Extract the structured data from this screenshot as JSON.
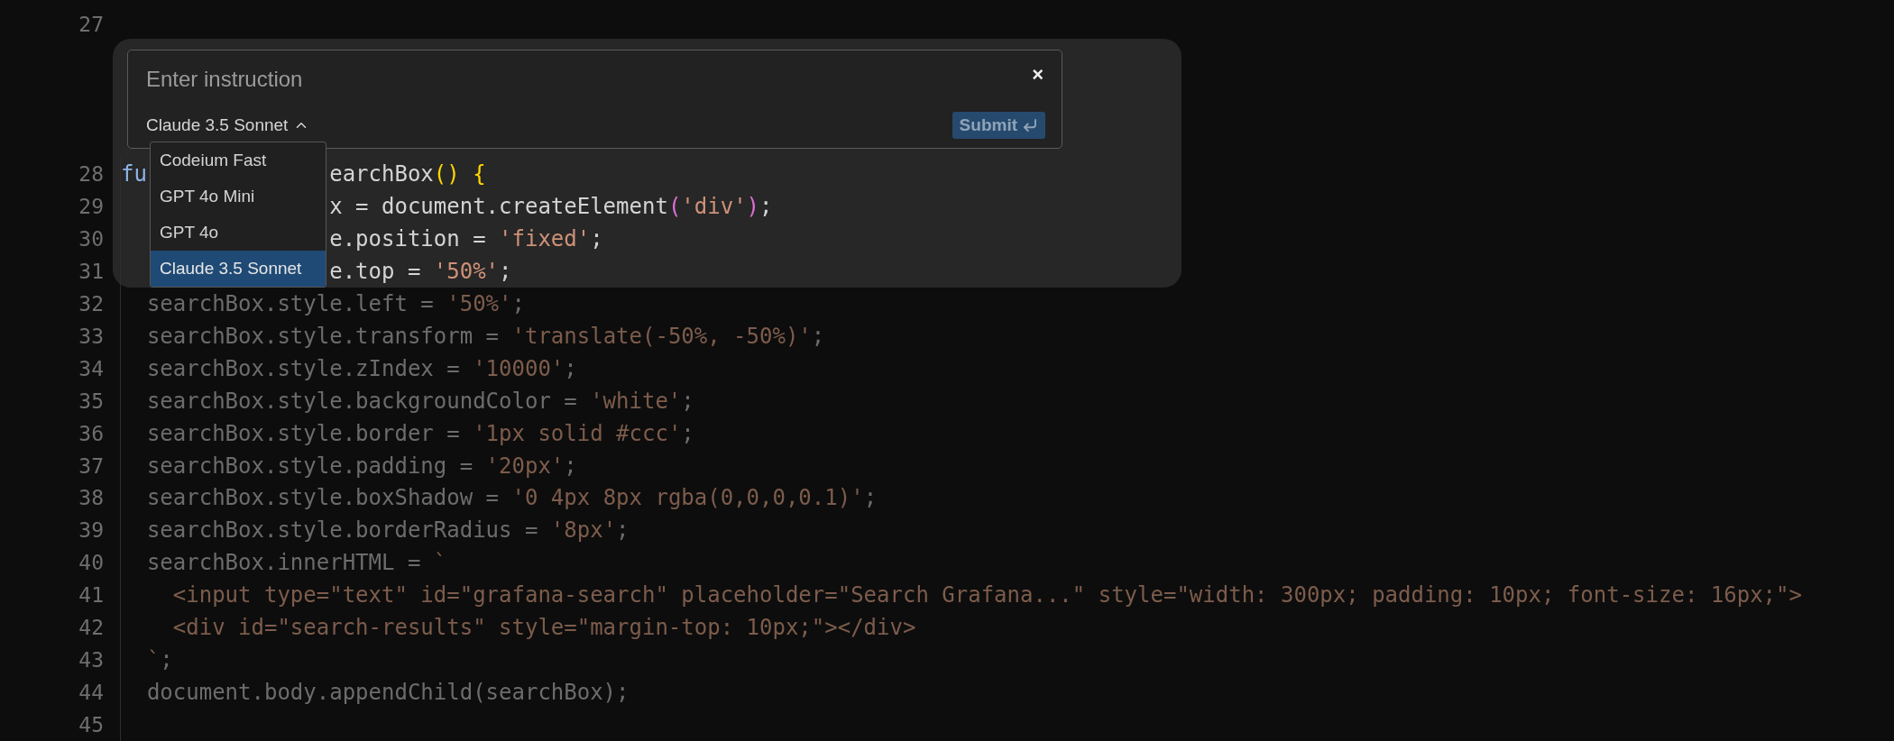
{
  "editor": {
    "lines": [
      {
        "number": "27"
      },
      {
        "number": "28",
        "dimmed": false,
        "covered": true,
        "lead": [
          {
            "kind": "keyword",
            "text": "fu"
          }
        ],
        "tokens": [
          {
            "kind": "plain",
            "text": "earchBox"
          },
          {
            "kind": "bracket",
            "text": "() {"
          }
        ]
      },
      {
        "number": "29",
        "dimmed": false,
        "covered": true,
        "tokens": [
          {
            "kind": "plain",
            "text": "x = document.createElement"
          },
          {
            "kind": "paren",
            "text": "("
          },
          {
            "kind": "string",
            "text": "'div'"
          },
          {
            "kind": "paren",
            "text": ")"
          },
          {
            "kind": "plain",
            "text": ";"
          }
        ]
      },
      {
        "number": "30",
        "dimmed": false,
        "covered": true,
        "tokens": [
          {
            "kind": "plain",
            "text": "e.position = "
          },
          {
            "kind": "string",
            "text": "'fixed'"
          },
          {
            "kind": "plain",
            "text": ";"
          }
        ]
      },
      {
        "number": "31",
        "dimmed": false,
        "covered": true,
        "tokens": [
          {
            "kind": "plain",
            "text": "e.top = "
          },
          {
            "kind": "string",
            "text": "'50%'"
          },
          {
            "kind": "plain",
            "text": ";"
          }
        ]
      },
      {
        "number": "32",
        "dimmed": true,
        "tokens": [
          {
            "kind": "plain",
            "text": "  searchBox.style.left = "
          },
          {
            "kind": "string",
            "text": "'50%'"
          },
          {
            "kind": "plain",
            "text": ";"
          }
        ]
      },
      {
        "number": "33",
        "dimmed": true,
        "tokens": [
          {
            "kind": "plain",
            "text": "  searchBox.style.transform = "
          },
          {
            "kind": "string",
            "text": "'translate(-50%, -50%)'"
          },
          {
            "kind": "plain",
            "text": ";"
          }
        ]
      },
      {
        "number": "34",
        "dimmed": true,
        "tokens": [
          {
            "kind": "plain",
            "text": "  searchBox.style.zIndex = "
          },
          {
            "kind": "string",
            "text": "'10000'"
          },
          {
            "kind": "plain",
            "text": ";"
          }
        ]
      },
      {
        "number": "35",
        "dimmed": true,
        "tokens": [
          {
            "kind": "plain",
            "text": "  searchBox.style.backgroundColor = "
          },
          {
            "kind": "string",
            "text": "'white'"
          },
          {
            "kind": "plain",
            "text": ";"
          }
        ]
      },
      {
        "number": "36",
        "dimmed": true,
        "tokens": [
          {
            "kind": "plain",
            "text": "  searchBox.style.border = "
          },
          {
            "kind": "string",
            "text": "'1px solid #ccc'"
          },
          {
            "kind": "plain",
            "text": ";"
          }
        ]
      },
      {
        "number": "37",
        "dimmed": true,
        "tokens": [
          {
            "kind": "plain",
            "text": "  searchBox.style.padding = "
          },
          {
            "kind": "string",
            "text": "'20px'"
          },
          {
            "kind": "plain",
            "text": ";"
          }
        ]
      },
      {
        "number": "38",
        "dimmed": true,
        "tokens": [
          {
            "kind": "plain",
            "text": "  searchBox.style.boxShadow = "
          },
          {
            "kind": "string",
            "text": "'0 4px 8px rgba(0,0,0,0.1)'"
          },
          {
            "kind": "plain",
            "text": ";"
          }
        ]
      },
      {
        "number": "39",
        "dimmed": true,
        "tokens": [
          {
            "kind": "plain",
            "text": "  searchBox.style.borderRadius = "
          },
          {
            "kind": "string",
            "text": "'8px'"
          },
          {
            "kind": "plain",
            "text": ";"
          }
        ]
      },
      {
        "number": "40",
        "dimmed": true,
        "tokens": [
          {
            "kind": "plain",
            "text": "  searchBox.innerHTML = "
          },
          {
            "kind": "string",
            "text": "`"
          }
        ]
      },
      {
        "number": "41",
        "dimmed": true,
        "tokens": [
          {
            "kind": "string",
            "text": "    <input type=\"text\" id=\"grafana-search\" placeholder=\"Search Grafana...\" style=\"width: 300px; padding: 10px; font-size: 16px;\">"
          }
        ]
      },
      {
        "number": "42",
        "dimmed": true,
        "tokens": [
          {
            "kind": "string",
            "text": "    <div id=\"search-results\" style=\"margin-top: 10px;\"></div>"
          }
        ]
      },
      {
        "number": "43",
        "dimmed": true,
        "tokens": [
          {
            "kind": "string",
            "text": "  `"
          },
          {
            "kind": "plain",
            "text": ";"
          }
        ]
      },
      {
        "number": "44",
        "dimmed": true,
        "tokens": [
          {
            "kind": "plain",
            "text": "  document.body.appendChild(searchBox);"
          }
        ]
      },
      {
        "number": "45"
      }
    ]
  },
  "inline_edit": {
    "placeholder": "Enter instruction",
    "close": "×",
    "model": "Claude 3.5 Sonnet",
    "expanded": true,
    "submit": "Submit",
    "models": [
      {
        "label": "Codeium Fast",
        "selected": false
      },
      {
        "label": "GPT 4o Mini",
        "selected": false
      },
      {
        "label": "GPT 4o",
        "selected": false
      },
      {
        "label": "Claude 3.5 Sonnet",
        "selected": true
      }
    ]
  }
}
